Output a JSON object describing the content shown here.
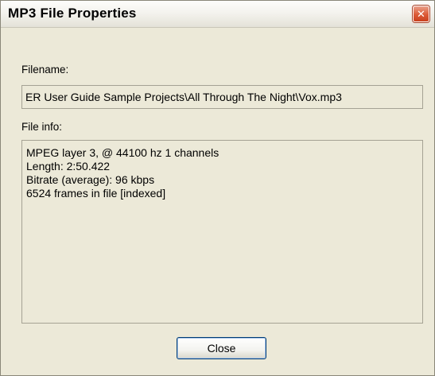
{
  "window": {
    "title": "MP3 File Properties",
    "close_glyph": "✕"
  },
  "filename": {
    "label": "Filename:",
    "value": "ER User Guide Sample Projects\\All Through The Night\\Vox.mp3"
  },
  "file_info": {
    "label": "File info:",
    "lines": [
      "MPEG layer 3, @ 44100 hz 1 channels",
      "Length: 2:50.422",
      "Bitrate (average): 96 kbps",
      "6524 frames in file [indexed]"
    ]
  },
  "buttons": {
    "close_label": "Close"
  },
  "colors": {
    "window_bg": "#ece9d8",
    "close_x_red": "#dc5a36",
    "button_border": "#003c74"
  }
}
